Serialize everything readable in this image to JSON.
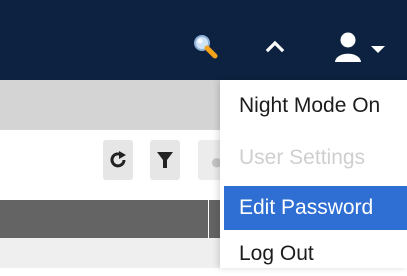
{
  "header": {
    "icons": [
      "search-tool-icon",
      "chevron-up-icon",
      "user-icon",
      "caret-down-icon"
    ]
  },
  "toolbar": {
    "icons": [
      "refresh-icon",
      "filter-icon"
    ]
  },
  "user_menu": {
    "items": [
      {
        "label": "Night Mode On",
        "state": "enabled"
      },
      {
        "label": "User Settings",
        "state": "disabled"
      },
      {
        "label": "Edit Password",
        "state": "highlighted"
      },
      {
        "label": "Log Out",
        "state": "enabled"
      }
    ]
  },
  "colors": {
    "header_bg": "#0d2240",
    "highlight": "#2f6fd3",
    "subbar_bg": "#d4d4d4",
    "grid_header": "#646464",
    "disabled_text": "#cfcfcf"
  }
}
